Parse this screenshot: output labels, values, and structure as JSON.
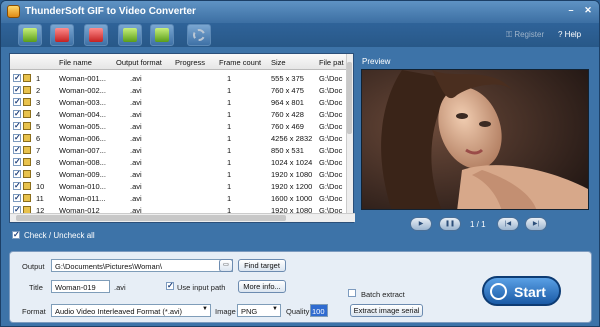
{
  "window": {
    "title": "ThunderSoft GIF to Video Converter"
  },
  "toplinks": {
    "register": "Register",
    "help": "Help"
  },
  "icons": {
    "add_files": "add-files-icon",
    "add_folder": "add-folder-icon",
    "remove": "remove-icon",
    "move_up": "move-up-icon",
    "move_down": "move-down-icon",
    "settings": "gear-icon"
  },
  "table": {
    "columns": [
      "File name",
      "Output format",
      "Progress",
      "Frame count",
      "Size",
      "File pat"
    ],
    "rows": [
      [
        "1",
        "Woman-001...",
        ".avi",
        "",
        "1",
        "555 x 375",
        "G:\\Doc"
      ],
      [
        "2",
        "Woman-002...",
        ".avi",
        "",
        "1",
        "760 x 475",
        "G:\\Doc"
      ],
      [
        "3",
        "Woman-003...",
        ".avi",
        "",
        "1",
        "964 x 801",
        "G:\\Doc"
      ],
      [
        "4",
        "Woman-004...",
        ".avi",
        "",
        "1",
        "760 x 428",
        "G:\\Doc"
      ],
      [
        "5",
        "Woman-005...",
        ".avi",
        "",
        "1",
        "760 x 469",
        "G:\\Doc"
      ],
      [
        "6",
        "Woman-006...",
        ".avi",
        "",
        "1",
        "4256 x 2832",
        "G:\\Doc"
      ],
      [
        "7",
        "Woman-007...",
        ".avi",
        "",
        "1",
        "850 x 531",
        "G:\\Doc"
      ],
      [
        "8",
        "Woman-008...",
        ".avi",
        "",
        "1",
        "1024 x 1024",
        "G:\\Doc"
      ],
      [
        "9",
        "Woman-009...",
        ".avi",
        "",
        "1",
        "1920 x 1080",
        "G:\\Doc"
      ],
      [
        "10",
        "Woman-010...",
        ".avi",
        "",
        "1",
        "1920 x 1200",
        "G:\\Doc"
      ],
      [
        "11",
        "Woman-011...",
        ".avi",
        "",
        "1",
        "1600 x 1000",
        "G:\\Doc"
      ],
      [
        "12",
        "Woman-012",
        ".avi",
        "",
        "1",
        "1920 x 1080",
        "G:\\Doc"
      ]
    ]
  },
  "check_all": {
    "label": "Check / Uncheck all"
  },
  "preview": {
    "label": "Preview",
    "counter": "1 / 1"
  },
  "output": {
    "label": "Output",
    "path": "G:\\Documents\\Pictures\\Woman\\",
    "find_target": "Find target",
    "title_label": "Title",
    "title_value": "Woman-019",
    "ext": ".avi",
    "use_input_path_label": "Use input path",
    "more_info": "More info...",
    "batch_extract_label": "Batch extract",
    "format_label": "Format",
    "format_value": "Audio Video Interleaved Format (*.avi)",
    "image_label": "Image",
    "image_value": "PNG",
    "quality_label": "Quality",
    "quality_value": "100",
    "extract_serial": "Extract image serial"
  },
  "start": {
    "label": "Start"
  },
  "colors": {
    "accent": "#3d73a8",
    "start_button": "#2f78c8",
    "panel": "#e7eef6"
  }
}
